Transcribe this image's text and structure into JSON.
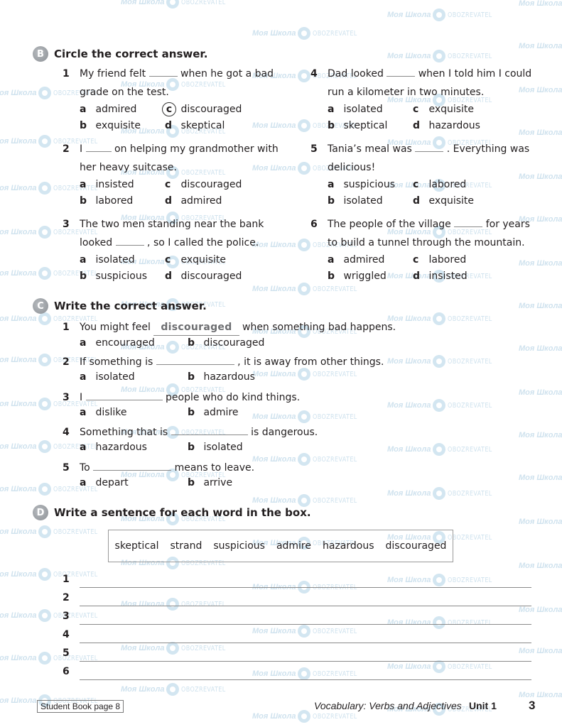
{
  "watermark": {
    "brand1": "Моя Школа",
    "brand2": "OBOZREVATEL"
  },
  "sectionB": {
    "badge": "B",
    "title": "Circle the correct answer.",
    "questions": [
      {
        "num": "1",
        "before": "My friend felt",
        "after": "when he got a bad grade on the test.",
        "options": [
          {
            "l": "a",
            "t": "admired"
          },
          {
            "l": "c",
            "t": "discouraged",
            "circled": true
          },
          {
            "l": "b",
            "t": "exquisite"
          },
          {
            "l": "d",
            "t": "skeptical"
          }
        ]
      },
      {
        "num": "2",
        "before": "I",
        "after": "on helping my grandmother with her heavy suitcase.",
        "options": [
          {
            "l": "a",
            "t": "insisted"
          },
          {
            "l": "c",
            "t": "discouraged"
          },
          {
            "l": "b",
            "t": "labored"
          },
          {
            "l": "d",
            "t": "admired"
          }
        ]
      },
      {
        "num": "3",
        "before": "The two men standing near the bank looked",
        "after": ", so I called the police.",
        "options": [
          {
            "l": "a",
            "t": "isolated"
          },
          {
            "l": "c",
            "t": "exquisite"
          },
          {
            "l": "b",
            "t": "suspicious"
          },
          {
            "l": "d",
            "t": "discouraged"
          }
        ]
      },
      {
        "num": "4",
        "before": "Dad looked",
        "after": "when I told him I could run a kilometer in two minutes.",
        "options": [
          {
            "l": "a",
            "t": "isolated"
          },
          {
            "l": "c",
            "t": "exquisite"
          },
          {
            "l": "b",
            "t": "skeptical"
          },
          {
            "l": "d",
            "t": "hazardous"
          }
        ]
      },
      {
        "num": "5",
        "before": "Tania’s meal was",
        "after": ". Everything was delicious!",
        "options": [
          {
            "l": "a",
            "t": "suspicious"
          },
          {
            "l": "c",
            "t": "labored"
          },
          {
            "l": "b",
            "t": "isolated"
          },
          {
            "l": "d",
            "t": "exquisite"
          }
        ]
      },
      {
        "num": "6",
        "before": "The people of the village",
        "after": "for years to build a tunnel through the mountain.",
        "options": [
          {
            "l": "a",
            "t": "admired"
          },
          {
            "l": "c",
            "t": "labored"
          },
          {
            "l": "b",
            "t": "wriggled"
          },
          {
            "l": "d",
            "t": "insisted"
          }
        ]
      }
    ]
  },
  "sectionC": {
    "badge": "C",
    "title": "Write the correct answer.",
    "questions": [
      {
        "num": "1",
        "before": "You might feel",
        "answer": "discouraged",
        "after": "when something bad happens.",
        "options": [
          {
            "l": "a",
            "t": "encouraged"
          },
          {
            "l": "b",
            "t": "discouraged"
          }
        ]
      },
      {
        "num": "2",
        "before": "If something is",
        "answer": "",
        "after": ", it is away from other things.",
        "options": [
          {
            "l": "a",
            "t": "isolated"
          },
          {
            "l": "b",
            "t": "hazardous"
          }
        ]
      },
      {
        "num": "3",
        "before": "I",
        "answer": "",
        "after": "people who do kind things.",
        "options": [
          {
            "l": "a",
            "t": "dislike"
          },
          {
            "l": "b",
            "t": "admire"
          }
        ]
      },
      {
        "num": "4",
        "before": "Something that is",
        "answer": "",
        "after": "is dangerous.",
        "options": [
          {
            "l": "a",
            "t": "hazardous"
          },
          {
            "l": "b",
            "t": "isolated"
          }
        ]
      },
      {
        "num": "5",
        "before": "To",
        "answer": "",
        "after": "means to leave.",
        "options": [
          {
            "l": "a",
            "t": "depart"
          },
          {
            "l": "b",
            "t": "arrive"
          }
        ]
      }
    ]
  },
  "sectionD": {
    "badge": "D",
    "title": "Write a sentence for each word in the box.",
    "words": [
      "skeptical",
      "strand",
      "suspicious",
      "admire",
      "hazardous",
      "discouraged"
    ],
    "lines": [
      "1",
      "2",
      "3",
      "4",
      "5",
      "6"
    ]
  },
  "footer": {
    "student_book": "Student Book page 8",
    "topic": "Vocabulary: Verbs and Adjectives",
    "unit": "Unit 1",
    "page": "3"
  }
}
